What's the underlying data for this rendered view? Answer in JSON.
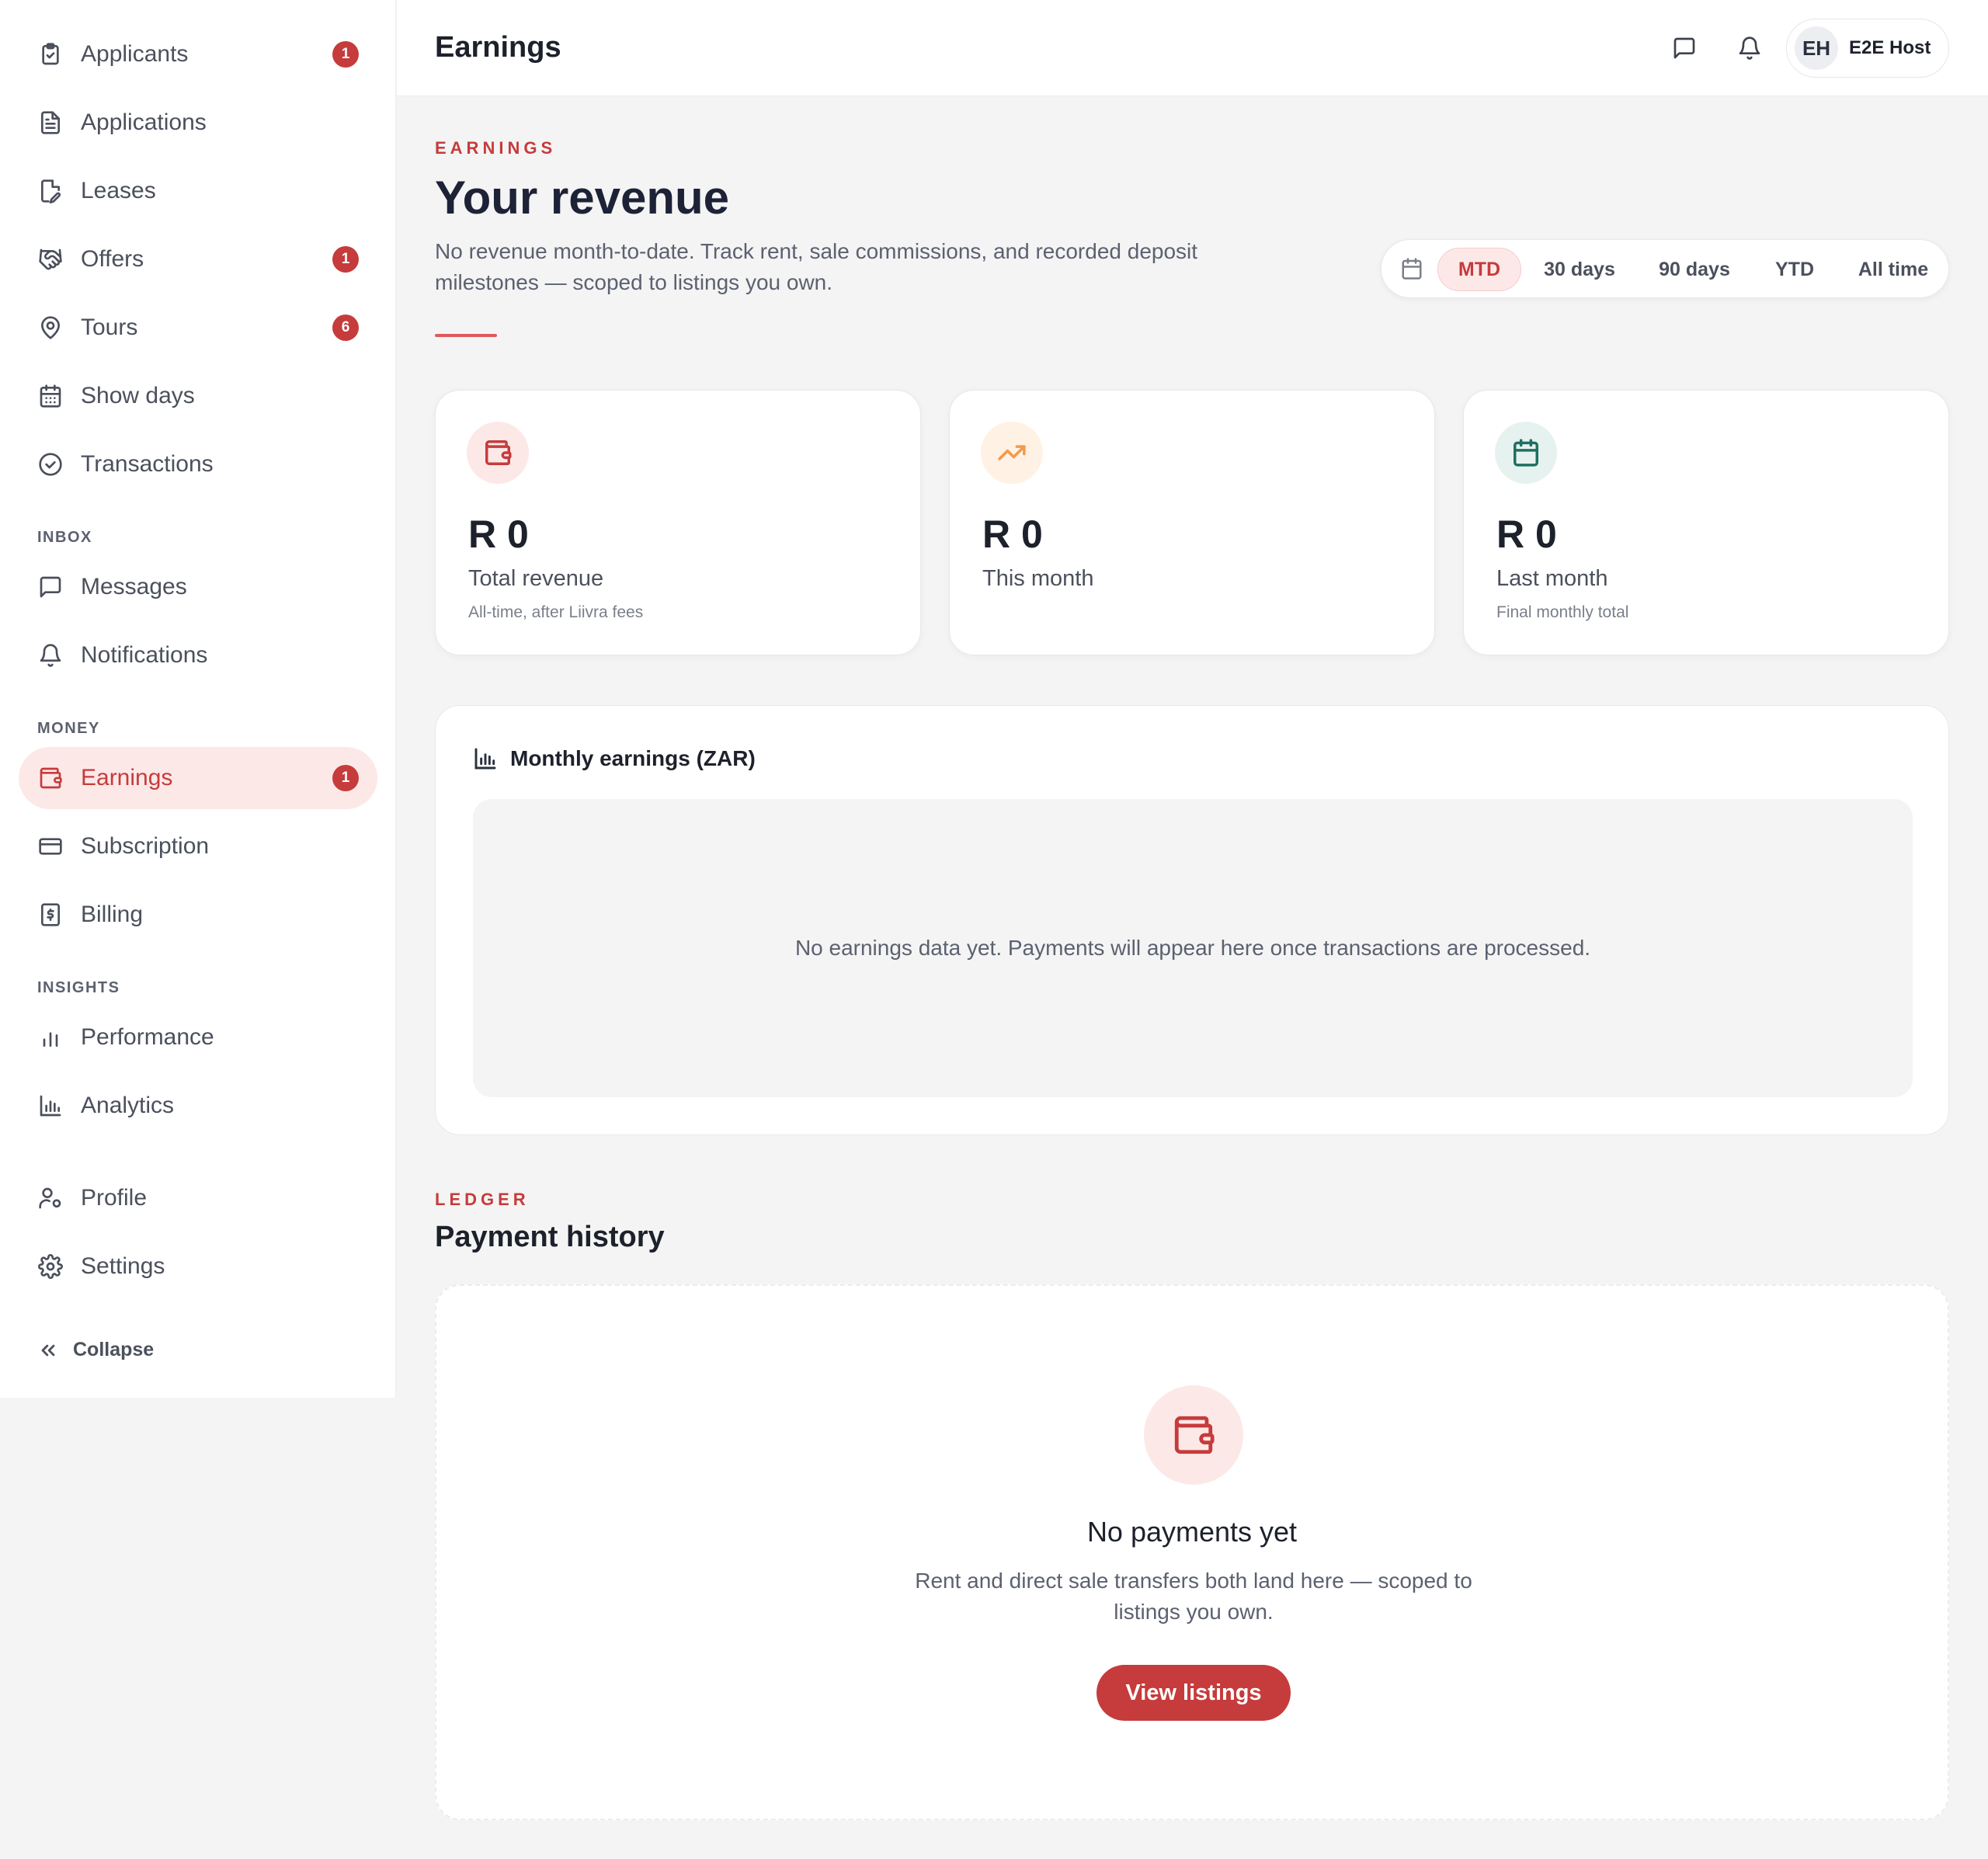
{
  "sidebar": {
    "items": [
      {
        "label": "Applicants",
        "badge": "1",
        "icon": "clipboard-icon"
      },
      {
        "label": "Applications",
        "badge": null,
        "icon": "document-icon"
      },
      {
        "label": "Leases",
        "badge": null,
        "icon": "file-edit-icon"
      },
      {
        "label": "Offers",
        "badge": "1",
        "icon": "handshake-icon"
      },
      {
        "label": "Tours",
        "badge": "6",
        "icon": "map-pin-icon"
      },
      {
        "label": "Show days",
        "badge": null,
        "icon": "calendar-icon"
      },
      {
        "label": "Transactions",
        "badge": null,
        "icon": "check-circle-icon"
      }
    ],
    "inbox_title": "INBOX",
    "inbox": [
      {
        "label": "Messages",
        "icon": "message-icon"
      },
      {
        "label": "Notifications",
        "icon": "bell-icon"
      }
    ],
    "money_title": "MONEY",
    "money": [
      {
        "label": "Earnings",
        "badge": "1",
        "icon": "wallet-icon",
        "active": true
      },
      {
        "label": "Subscription",
        "icon": "credit-card-icon"
      },
      {
        "label": "Billing",
        "icon": "receipt-icon"
      }
    ],
    "insights_title": "INSIGHTS",
    "insights": [
      {
        "label": "Performance",
        "icon": "bar-chart-icon"
      },
      {
        "label": "Analytics",
        "icon": "chart-icon"
      }
    ],
    "account": [
      {
        "label": "Profile",
        "icon": "user-cog-icon"
      },
      {
        "label": "Settings",
        "icon": "gear-icon"
      }
    ],
    "collapse_label": "Collapse"
  },
  "topbar": {
    "title": "Earnings",
    "user_initials": "EH",
    "user_name": "E2E Host"
  },
  "header": {
    "eyebrow": "EARNINGS",
    "title": "Your revenue",
    "description": "No revenue month-to-date. Track rent, sale commissions, and recorded deposit milestones — scoped to listings you own."
  },
  "range": {
    "options": [
      "MTD",
      "30 days",
      "90 days",
      "YTD",
      "All time"
    ],
    "selected": "MTD"
  },
  "stats": [
    {
      "value": "R 0",
      "label": "Total revenue",
      "sub": "All-time, after Liivra fees",
      "icon": "wallet-icon"
    },
    {
      "value": "R 0",
      "label": "This month",
      "sub": "",
      "icon": "trending-up-icon"
    },
    {
      "value": "R 0",
      "label": "Last month",
      "sub": "Final monthly total",
      "icon": "calendar-icon"
    }
  ],
  "chart": {
    "title": "Monthly earnings (ZAR)",
    "empty_text": "No earnings data yet. Payments will appear here once transactions are processed."
  },
  "ledger": {
    "eyebrow": "LEDGER",
    "title": "Payment history",
    "empty_title": "No payments yet",
    "empty_desc": "Rent and direct sale transfers both land here — scoped to listings you own.",
    "button": "View listings"
  },
  "colors": {
    "accent": "#c63b3b",
    "accent_soft": "#fde8e8",
    "orange": "#f2994a",
    "orange_soft": "#fff1e4",
    "teal": "#1f6f63",
    "teal_soft": "#e6f2ef"
  }
}
